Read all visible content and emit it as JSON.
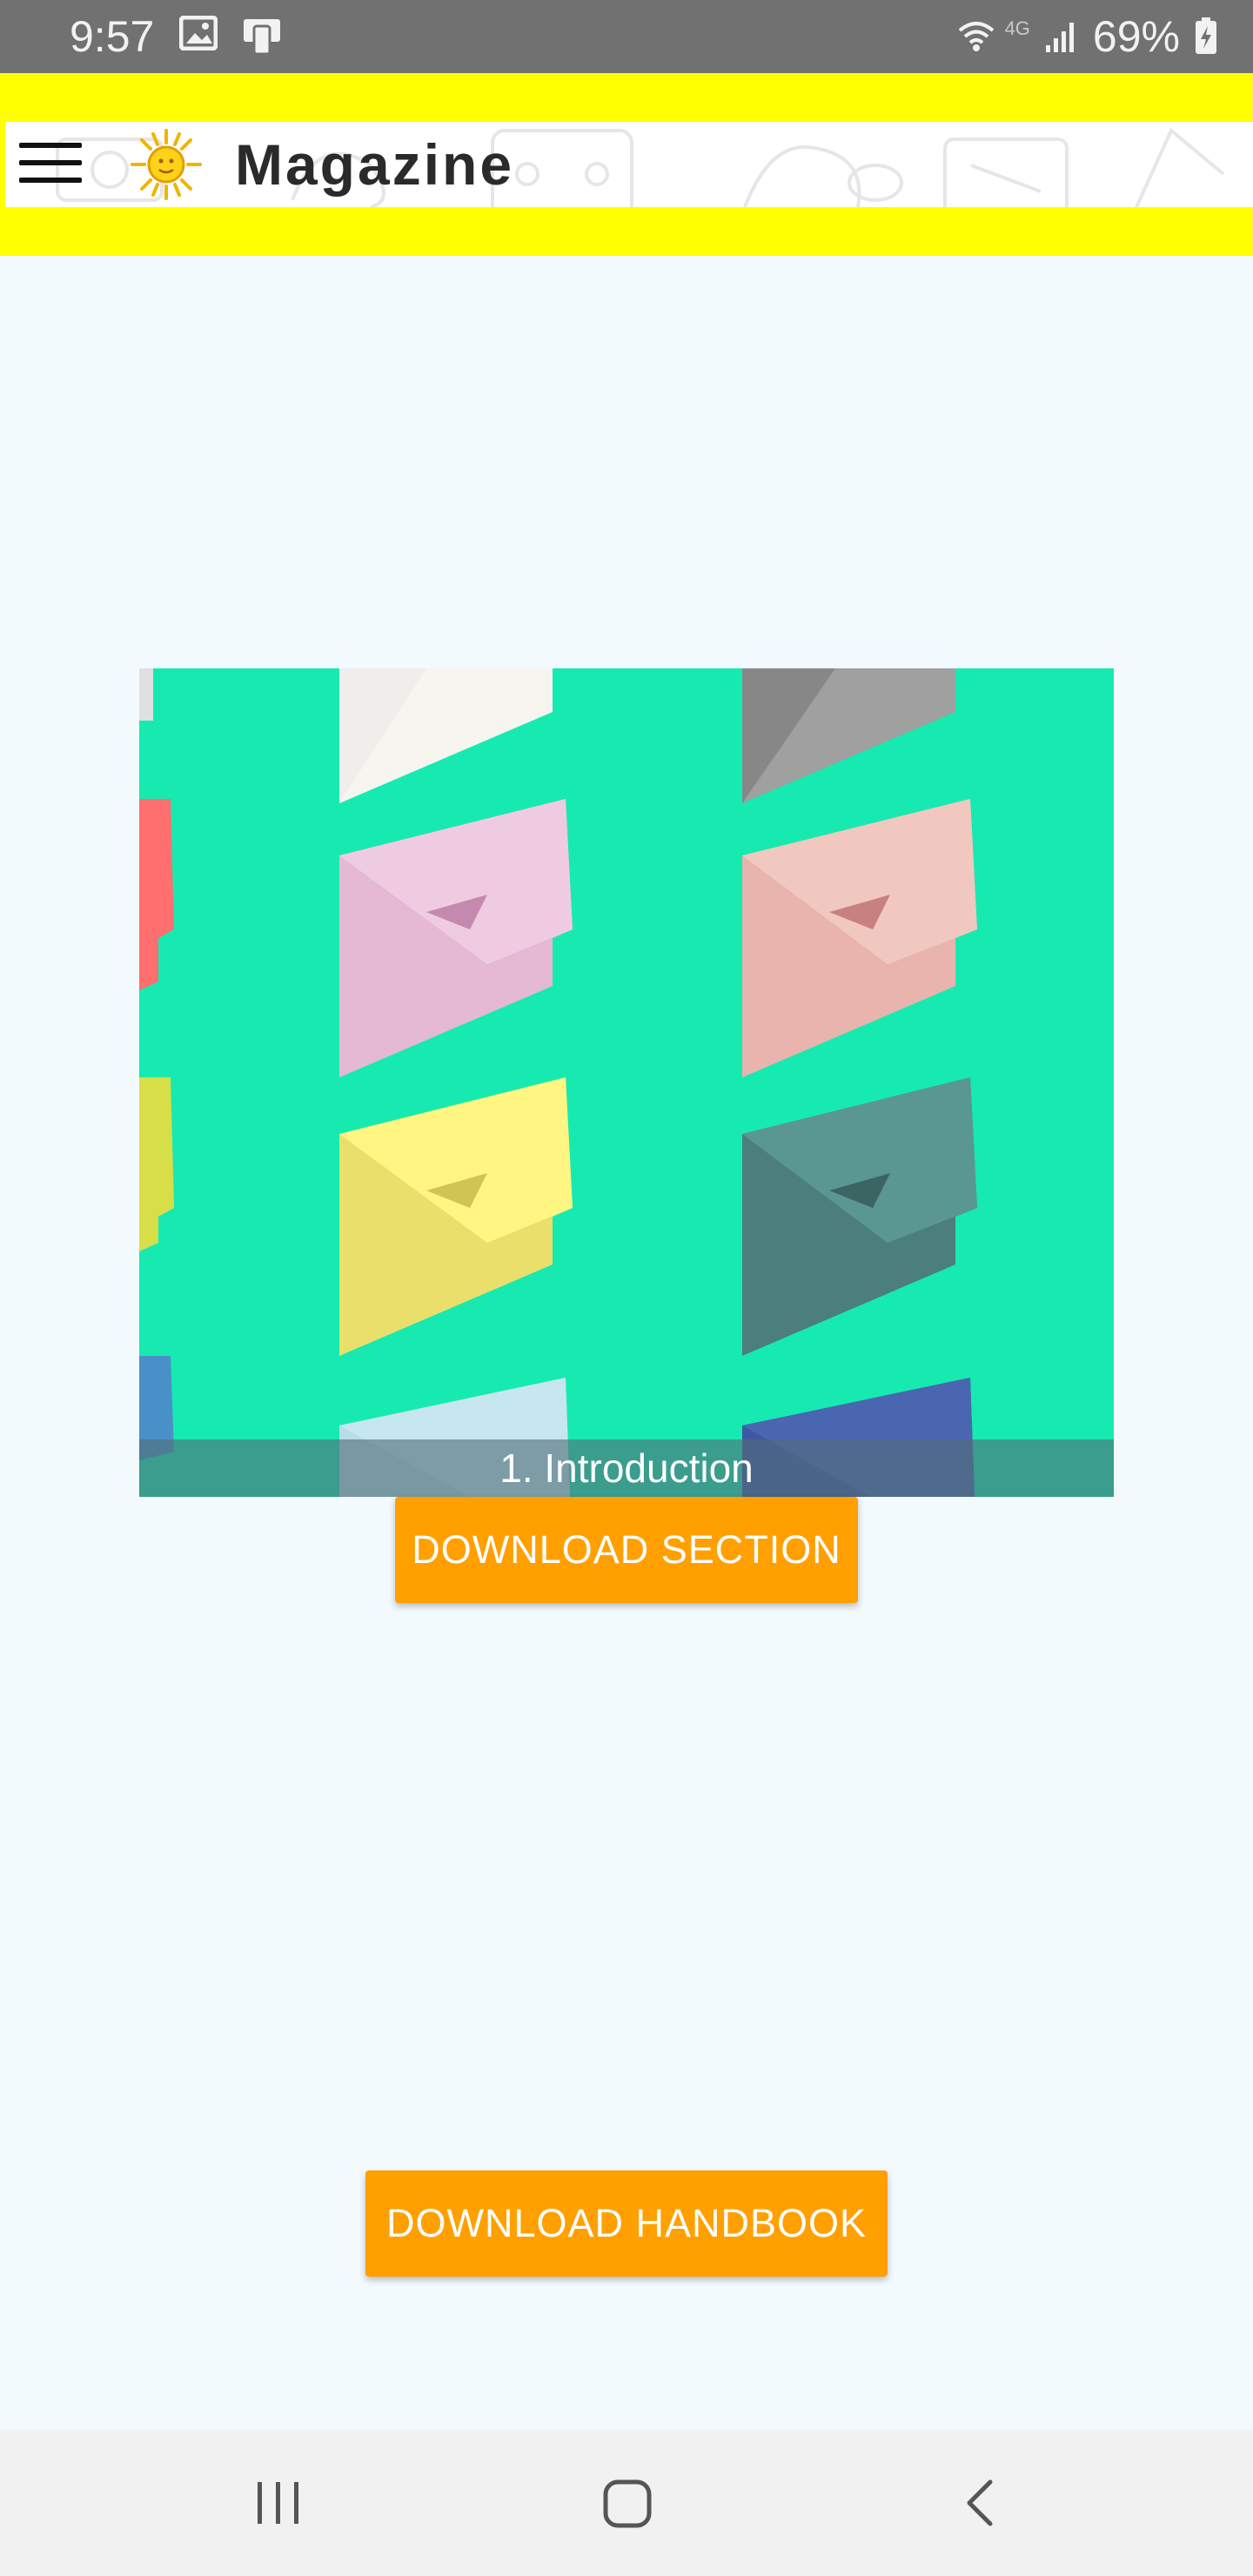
{
  "status_bar": {
    "time": "9:57",
    "network": "4G",
    "battery": "69%",
    "icons": [
      "image-icon",
      "device-icon",
      "wifi-icon",
      "signal-icon",
      "battery-charging-icon"
    ]
  },
  "app_bar": {
    "title": "Magazine",
    "brand_color": "#ffff00",
    "icons": [
      "menu-icon",
      "sun-logo-icon"
    ]
  },
  "section": {
    "caption": "1. Introduction",
    "background_color": "#17eab0",
    "download_label": "DOWNLOAD SECTION"
  },
  "footer_action": {
    "download_label": "DOWNLOAD HANDBOOK",
    "accent_color": "#ffa000"
  },
  "nav_bar": {
    "icons": [
      "recent-apps-icon",
      "home-icon",
      "back-icon"
    ]
  }
}
